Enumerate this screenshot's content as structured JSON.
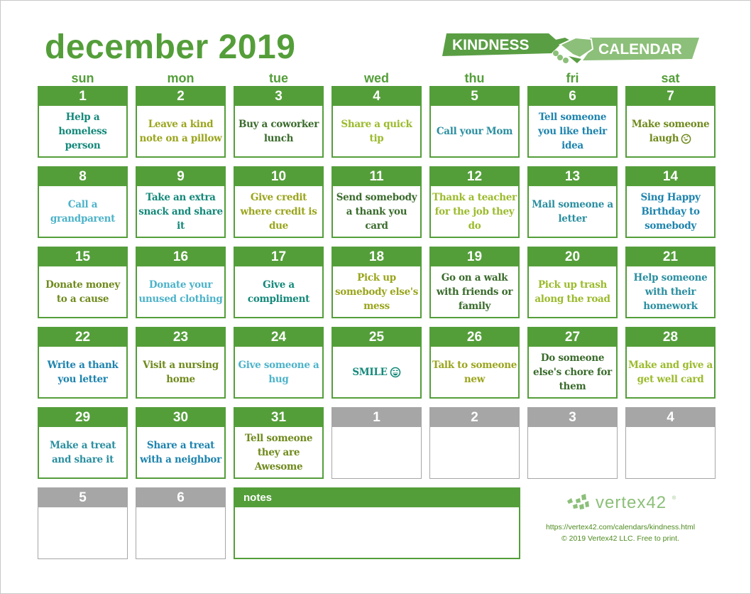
{
  "title": "december 2019",
  "logo": {
    "left_text": "KINDNESS",
    "right_text": "CALENDAR",
    "icon": "handshake-icon"
  },
  "colors": {
    "brand_green": "#549e3a",
    "logo_dark_green": "#5a9e44",
    "logo_light_green": "#8cbf79",
    "gray_header": "#a6a6a6",
    "teal": "#14897a",
    "olive": "#8fa51c",
    "dark_green": "#3a6b2c",
    "lime": "#9bbb2c",
    "blue": "#1e84ae",
    "light_blue": "#4db3c9",
    "mid_teal": "#2b8fa0",
    "olive_dark": "#7f8a1c"
  },
  "days_of_week": [
    "sun",
    "mon",
    "tue",
    "wed",
    "thu",
    "fri",
    "sat"
  ],
  "weeks": [
    [
      {
        "day": "1",
        "text": "Help a homeless person",
        "color": "#14897a"
      },
      {
        "day": "2",
        "text": "Leave a kind note on a pillow",
        "color": "#9aa51c"
      },
      {
        "day": "3",
        "text": "Buy a coworker lunch",
        "color": "#3a6b2c"
      },
      {
        "day": "4",
        "text": "Share a quick tip",
        "color": "#9bbb2c"
      },
      {
        "day": "5",
        "text": "Call your Mom",
        "color": "#2b8fa0"
      },
      {
        "day": "6",
        "text": "Tell someone you like their idea",
        "color": "#1e84ae"
      },
      {
        "day": "7",
        "text": "Make someone laugh",
        "color": "#6f8a1c",
        "icon": "laughing-face-icon"
      }
    ],
    [
      {
        "day": "8",
        "text": "Call a grandparent",
        "color": "#4db3c9"
      },
      {
        "day": "9",
        "text": "Take an extra snack and share it",
        "color": "#14897a"
      },
      {
        "day": "10",
        "text": "Give credit where credit is due",
        "color": "#9aa51c"
      },
      {
        "day": "11",
        "text": "Send somebody a thank you card",
        "color": "#3a6b2c"
      },
      {
        "day": "12",
        "text": "Thank a teacher for the job they do",
        "color": "#9bbb2c"
      },
      {
        "day": "13",
        "text": "Mail someone a letter",
        "color": "#2b8fa0"
      },
      {
        "day": "14",
        "text": "Sing Happy Birthday to somebody",
        "color": "#1e84ae"
      }
    ],
    [
      {
        "day": "15",
        "text": "Donate money to a cause",
        "color": "#6f8a1c"
      },
      {
        "day": "16",
        "text": "Donate your unused clothing",
        "color": "#4db3c9"
      },
      {
        "day": "17",
        "text": "Give a compliment",
        "color": "#14897a"
      },
      {
        "day": "18",
        "text": "Pick up somebody else's mess",
        "color": "#9aa51c"
      },
      {
        "day": "19",
        "text": "Go on a walk with friends or family",
        "color": "#3a6b2c"
      },
      {
        "day": "20",
        "text": "Pick up trash along the road",
        "color": "#9bbb2c"
      },
      {
        "day": "21",
        "text": "Help someone with their homework",
        "color": "#2b8fa0"
      }
    ],
    [
      {
        "day": "22",
        "text": "Write a thank you letter",
        "color": "#1e84ae"
      },
      {
        "day": "23",
        "text": "Visit a nursing home",
        "color": "#6f8a1c"
      },
      {
        "day": "24",
        "text": "Give someone a hug",
        "color": "#4db3c9"
      },
      {
        "day": "25",
        "text": "SMILE",
        "color": "#14897a",
        "icon": "smiling-face-icon"
      },
      {
        "day": "26",
        "text": "Talk to someone new",
        "color": "#9aa51c"
      },
      {
        "day": "27",
        "text": "Do someone else's chore for them",
        "color": "#3a6b2c"
      },
      {
        "day": "28",
        "text": "Make and give a get well card",
        "color": "#9bbb2c"
      }
    ],
    [
      {
        "day": "29",
        "text": "Make a treat and share it",
        "color": "#2b8fa0"
      },
      {
        "day": "30",
        "text": "Share a treat with a neighbor",
        "color": "#1e84ae"
      },
      {
        "day": "31",
        "text": "Tell someone they are Awesome",
        "color": "#6f8a1c"
      },
      {
        "day": "1",
        "text": "",
        "gray": true
      },
      {
        "day": "2",
        "text": "",
        "gray": true
      },
      {
        "day": "3",
        "text": "",
        "gray": true
      },
      {
        "day": "4",
        "text": "",
        "gray": true
      }
    ],
    [
      {
        "day": "5",
        "text": "",
        "gray": true
      },
      {
        "day": "6",
        "text": "",
        "gray": true
      }
    ]
  ],
  "notes": {
    "label": "notes"
  },
  "footer": {
    "brand": "vertex42",
    "registered": "®",
    "url": "https://vertex42.com/calendars/kindness.html",
    "copyright": "© 2019 Vertex42 LLC. Free to print."
  }
}
